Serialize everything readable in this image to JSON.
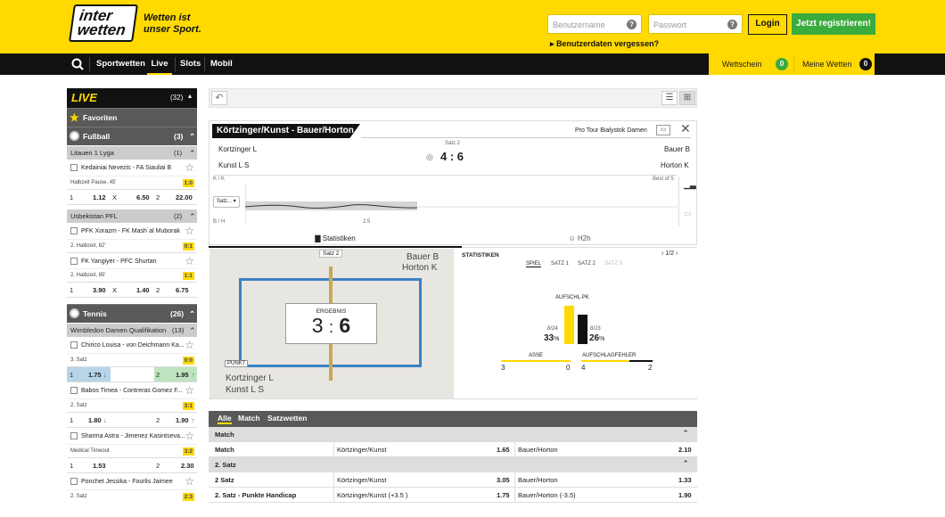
{
  "header": {
    "logo_line1": "inter",
    "logo_line2": "wetten",
    "slogan_line1": "Wetten ist",
    "slogan_line2": "unser Sport.",
    "username_placeholder": "Benutzername",
    "password_placeholder": "Passwort",
    "login": "Login",
    "register": "Jetzt registrieren!",
    "forgot": "Benutzerdaten vergessen?",
    "help": "?"
  },
  "nav": {
    "items": [
      "Sportwetten",
      "Live",
      "Slots",
      "Mobil"
    ],
    "wettschein": "Wettschein",
    "wettschein_count": "0",
    "meine_wetten": "Meine Wetten",
    "meine_wetten_count": "0"
  },
  "sidebar": {
    "live_label": "LIVE",
    "live_count": "(32)",
    "favoriten": "Favoriten",
    "fussball": {
      "label": "Fußball",
      "count": "(3)"
    },
    "groups": [
      {
        "league": "Litauen 1 Lyga",
        "count": "(1)",
        "matches": [
          {
            "name": "Kedainiai Nevezis - FA Siauliai B",
            "info": "Halbzeit Pause, 45'",
            "score": "1:0",
            "o1": "1.12",
            "ox": "6.50",
            "o2": "22.00"
          }
        ]
      },
      {
        "league": "Usbekistan PFL",
        "count": "(2)",
        "matches": [
          {
            "name": "PFK Xorazm - FK Mash`al Muborak",
            "info": "2. Halbzeit, 62'",
            "score": "0:1",
            "o1": "",
            "ox": "",
            "o2": ""
          },
          {
            "name": "FK Yangiyer - PFC Shurtan",
            "info": "2. Halbzeit, 85'",
            "score": "1:1",
            "o1": "3.90",
            "ox": "1.40",
            "o2": "6.75"
          }
        ]
      }
    ],
    "tennis": {
      "label": "Tennis",
      "count": "(26)",
      "league": "Wimbledon Damen Qualifikation",
      "league_count": "(13)",
      "matches": [
        {
          "name": "Chirico Louisa - von Deichmann Ka...",
          "info": "3. Satz",
          "score": "0:0",
          "o1": "1.75",
          "o2": "1.95"
        },
        {
          "name": "Babos Timea - Contreras Gomez F...",
          "info": "2. Satz",
          "score": "3:1",
          "o1": "1.80",
          "o2": "1.90"
        },
        {
          "name": "Sharma Astra - Jimenez Kasintseva...",
          "info": "Medical Timeout",
          "score": "3:2",
          "o1": "1.53",
          "o2": "2.30"
        },
        {
          "name": "Ponchet Jessika - Fourlis Jaimee",
          "info": "2. Satz",
          "score": "2:3",
          "o1": "",
          "o2": ""
        }
      ]
    },
    "x": "X",
    "one": "1",
    "two": "2"
  },
  "match": {
    "title": "Körtzinger/Kunst - Bauer/Horton",
    "tournament": "Pro Tour Bialystok Damen",
    "home1": "Kortzinger L",
    "home2": "Kunst L S",
    "away1": "Bauer B",
    "away2": "Horton K",
    "satz": "Satz 2",
    "score": "4 : 6",
    "kk": "K / K",
    "bh": "B / H",
    "best_of": "Best of 5",
    "select": "Satz...",
    "tick": "2:5"
  },
  "tabs": {
    "statistiken": "Statistiken",
    "h2h": "H2h"
  },
  "field": {
    "satz": "Satz 2",
    "away1": "Bauer B",
    "away2": "Horton K",
    "home1": "Kortzinger L",
    "home2": "Kunst L S",
    "ergebnis": "ERGEBNIS",
    "result_l": "3",
    "result_sep": ":",
    "result_r": "6",
    "punkt": "PUNKT"
  },
  "stats": {
    "title": "STATISTIKEN",
    "page": "1/2",
    "tabs": [
      "SPIEL",
      "SATZ 1",
      "SATZ 2",
      "SATZ 3"
    ],
    "aufschl": "AUFSCHL.PK",
    "left_frac": "8/24",
    "left_pct": "33",
    "right_frac": "8/23",
    "right_pct": "26",
    "pct_sign": "%",
    "asse": "ASSE",
    "asse_l": "3",
    "asse_r": "0",
    "fehler": "AUFSCHLAGFEHLER",
    "fehler_l": "4",
    "fehler_r": "2"
  },
  "bets": {
    "tabs": [
      "Alle",
      "Match",
      "Satzwetten"
    ],
    "sections": [
      {
        "title": "Match",
        "rows": [
          {
            "label": "Match",
            "home": "Körtzinger/Kunst",
            "o1": "1.65",
            "away": "Bauer/Horton",
            "o2": "2.10"
          }
        ]
      },
      {
        "title": "2. Satz",
        "rows": [
          {
            "label": "2 Satz",
            "home": "Körtzinger/Kunst",
            "o1": "3.05",
            "away": "Bauer/Horton",
            "o2": "1.33"
          },
          {
            "label": "2. Satz - Punkte Handicap",
            "home": "Körtzinger/Kunst (+3.5 )",
            "o1": "1.75",
            "away": "Bauer/Horton (-3.5)",
            "o2": "1.90"
          }
        ]
      }
    ]
  },
  "colors": {
    "brand": "#ffd900",
    "green": "#3aab3d",
    "dark": "#111111"
  }
}
